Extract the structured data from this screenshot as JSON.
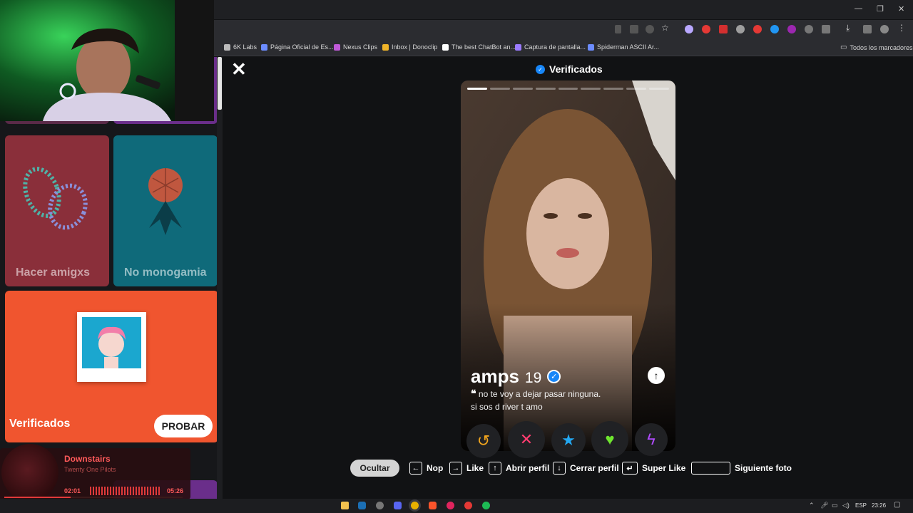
{
  "browser": {
    "bookmarks": [
      {
        "label": "6K Labs",
        "color": "#bbbbbb"
      },
      {
        "label": "Página Oficial de Es...",
        "color": "#6c8cff"
      },
      {
        "label": "Nexus Clips",
        "color": "#c05ad8"
      },
      {
        "label": "Inbox | Donoclip",
        "color": "#f0b429"
      },
      {
        "label": "The best ChatBot an...",
        "color": "#ffffff"
      },
      {
        "label": "Captura de pantalla...",
        "color": "#9b7bff"
      },
      {
        "label": "Spiderman ASCII Ar...",
        "color": "#6c8cff"
      }
    ],
    "all_bookmarks": "Todos los marcadores"
  },
  "sidebar": {
    "tiles": [
      {
        "label": "Hacer amigxs",
        "bg": "#8a2f3a"
      },
      {
        "label": "No monogamia",
        "bg": "#0f6a7a"
      }
    ],
    "verified_tile": {
      "label": "Verificados",
      "button": "PROBAR",
      "bg": "#f0552f"
    },
    "music": {
      "title": "Downstairs",
      "artist": "Twenty One Pilots",
      "elapsed": "02:01",
      "total": "05:26",
      "progress": 0.37
    }
  },
  "main": {
    "header_title": "Verificados",
    "close_icon": "close-icon",
    "photo_count": 9,
    "active_photo": 1,
    "profile": {
      "name": "amps",
      "age": "19",
      "bio_line1": "no te voy a dejar pasar ninguna.",
      "bio_line2": "si sos d river t amo"
    },
    "actions": [
      {
        "icon": "rewind-icon",
        "glyph": "↺",
        "color": "#f2a51d"
      },
      {
        "icon": "nope-icon",
        "glyph": "✕",
        "color": "#ff3d71"
      },
      {
        "icon": "superlike-icon",
        "glyph": "★",
        "color": "#23a8f2"
      },
      {
        "icon": "like-icon",
        "glyph": "♥",
        "color": "#6fe62f"
      },
      {
        "icon": "boost-icon",
        "glyph": "ϟ",
        "color": "#b14bff"
      }
    ],
    "hints": {
      "hide": "Ocultar",
      "nope": "Nop",
      "like": "Like",
      "open_profile": "Abrir perfil",
      "close_profile": "Cerrar perfil",
      "super_like": "Super Like",
      "next_photo": "Siguiente foto"
    }
  },
  "taskbar": {
    "lang": "ESP",
    "time": "23:26"
  }
}
